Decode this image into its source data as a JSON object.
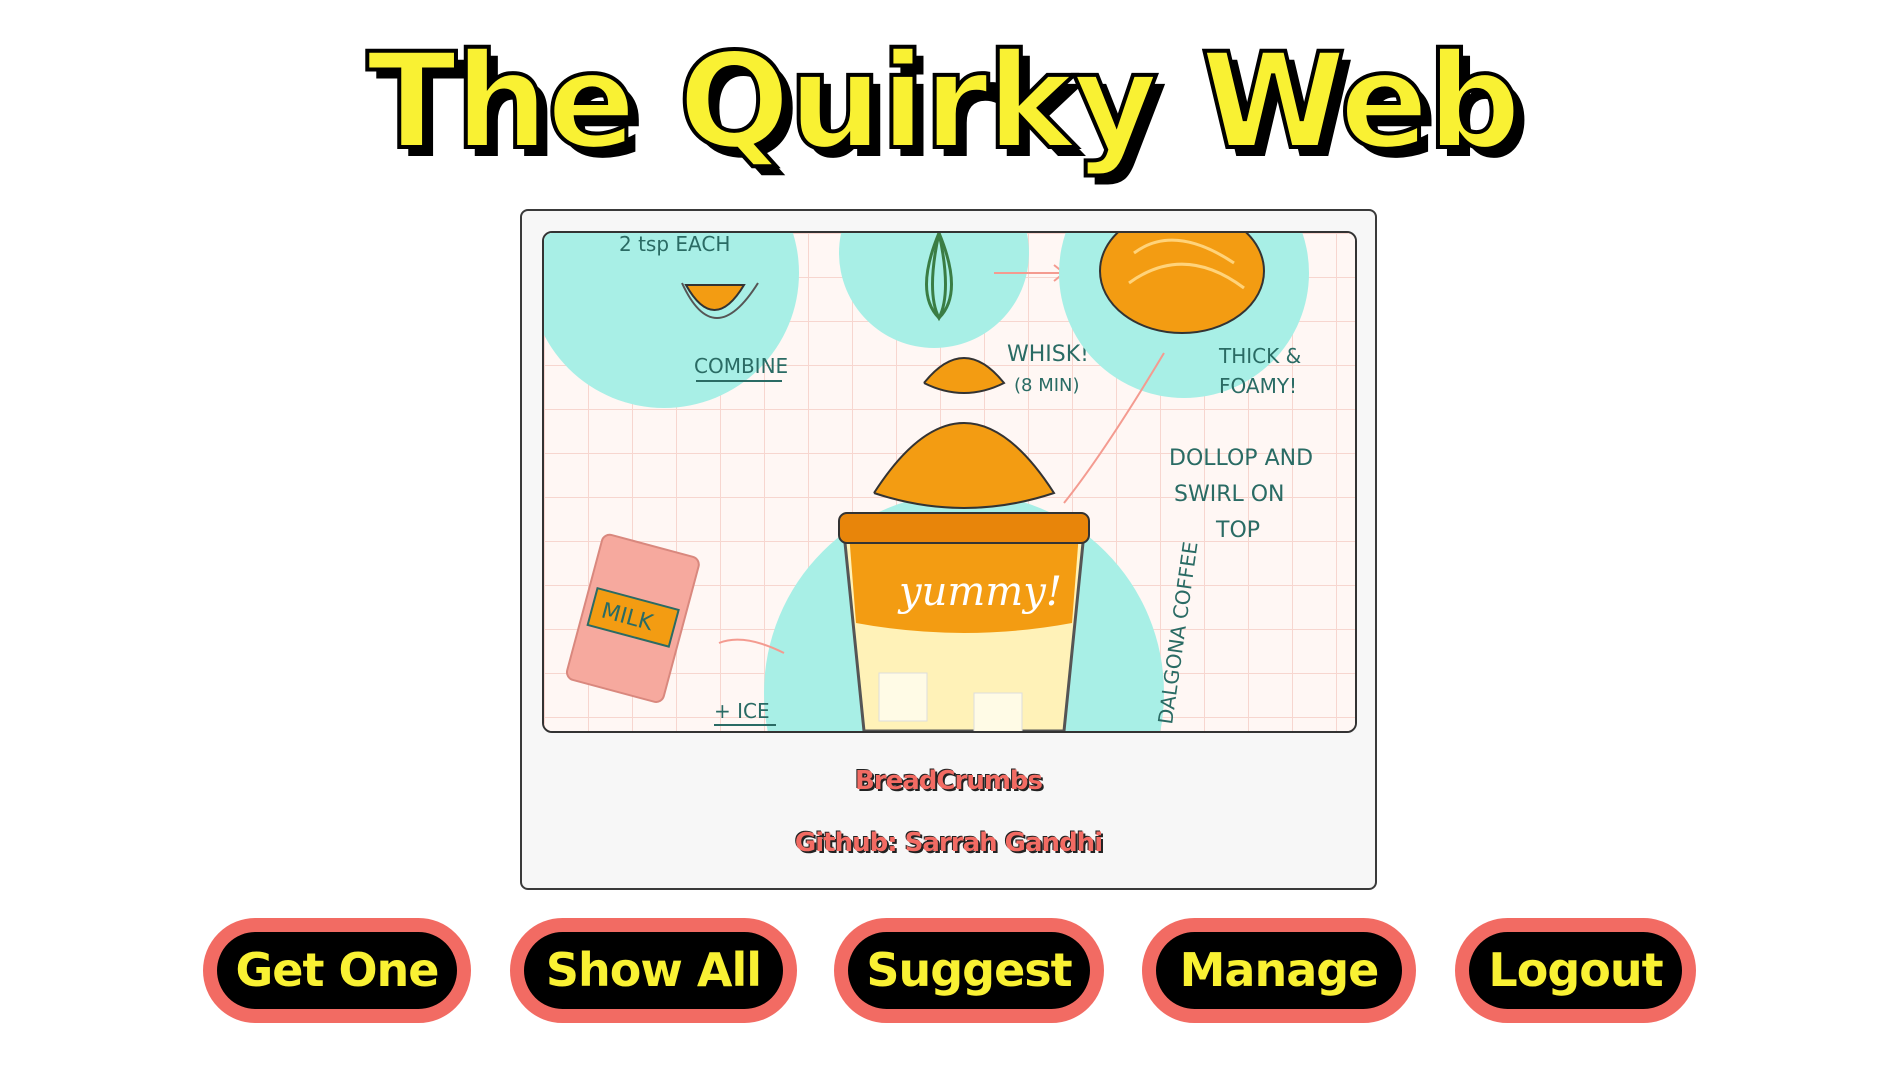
{
  "header": {
    "title": "The Quirky Web"
  },
  "card": {
    "image_description_labels": {
      "measure": "2 tsp EACH",
      "combine": "COMBINE",
      "whisk": "WHISK!",
      "whisk_time": "(8 MIN)",
      "thick": "THICK &",
      "foamy": "FOAMY!",
      "dollop_1": "DOLLOP AND",
      "dollop_2": "SWIRL ON",
      "dollop_3": "TOP",
      "milk": "MILK",
      "ice": "+ ICE",
      "cup": "yummy!",
      "side": "DALGONA COFFEE"
    },
    "title": "BreadCrumbs",
    "github": "Github: Sarrah Gandhi"
  },
  "nav": {
    "get_one": "Get One",
    "show_all": "Show All",
    "suggest": "Suggest",
    "manage": "Manage",
    "logout": "Logout"
  },
  "colors": {
    "title_fill": "#f9f133",
    "button_border": "#f26b63",
    "button_bg": "#000000",
    "button_text": "#f9f133",
    "mint": "#a8efe6",
    "orange": "#f39c12"
  }
}
